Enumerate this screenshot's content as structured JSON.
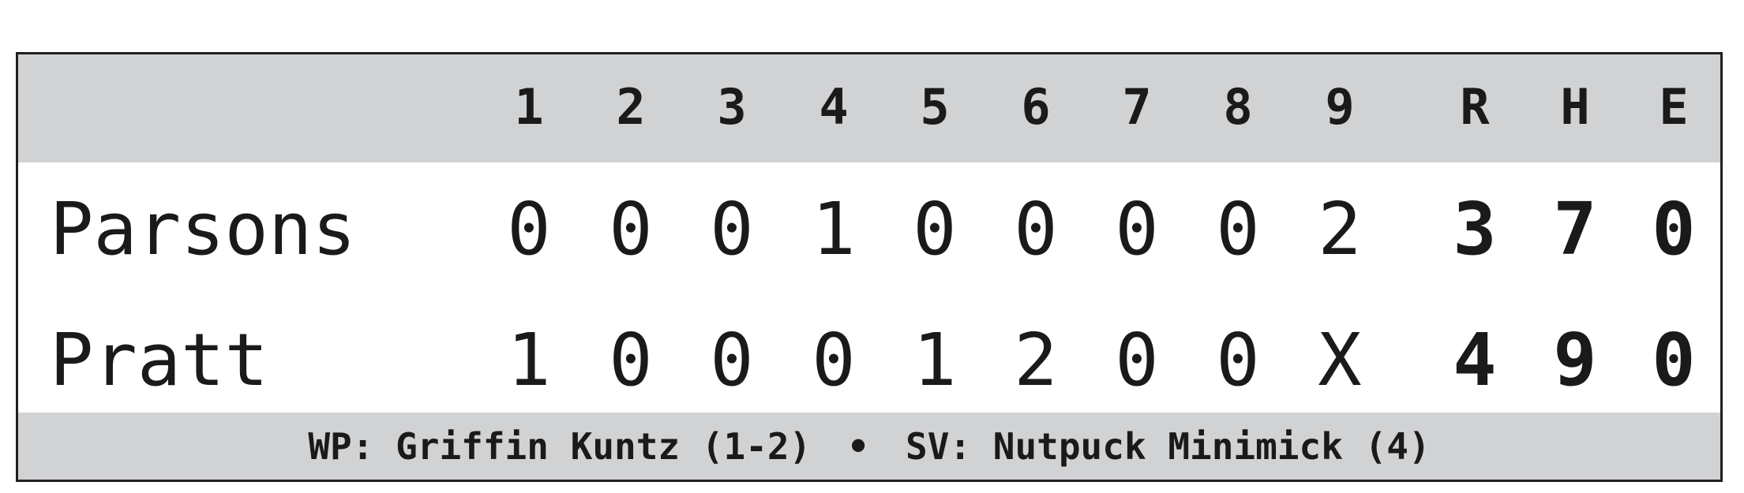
{
  "innings": [
    "1",
    "2",
    "3",
    "4",
    "5",
    "6",
    "7",
    "8",
    "9"
  ],
  "totals_headers": [
    "R",
    "H",
    "E"
  ],
  "teams": [
    {
      "name": "Parsons",
      "innings": [
        "0",
        "0",
        "0",
        "1",
        "0",
        "0",
        "0",
        "0",
        "2"
      ],
      "R": "3",
      "H": "7",
      "E": "0"
    },
    {
      "name": "Pratt",
      "innings": [
        "1",
        "0",
        "0",
        "0",
        "1",
        "2",
        "0",
        "0",
        "X"
      ],
      "R": "4",
      "H": "9",
      "E": "0"
    }
  ],
  "footer": {
    "wp": "WP: Griffin Kuntz (1-2)",
    "separator": "•",
    "sv": "SV: Nutpuck Minimick (4)"
  },
  "colors": {
    "band": "#d1d2d4",
    "border": "#1f1f1f",
    "text": "#1a1a1a"
  }
}
